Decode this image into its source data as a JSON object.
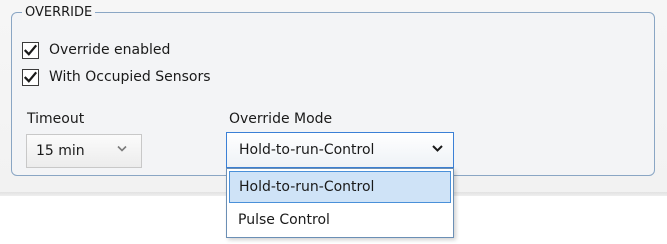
{
  "override_group": {
    "legend": "OVERRIDE",
    "override_enabled": {
      "label": "Override enabled",
      "checked": true
    },
    "with_occupied_sensors": {
      "label": "With Occupied Sensors",
      "checked": true
    },
    "timeout": {
      "label": "Timeout",
      "value": "15 min"
    },
    "override_mode": {
      "label": "Override Mode",
      "value": "Hold-to-run-Control",
      "options": [
        "Hold-to-run-Control",
        "Pulse Control"
      ],
      "highlighted_option": "Hold-to-run-Control",
      "expanded": true
    }
  },
  "icons": {
    "checkmark": "checkmark-icon",
    "chevron": "chevron-down-icon"
  },
  "colors": {
    "group_border": "#8aa6c4",
    "focus_border": "#3b80d6",
    "highlight_bg": "#cfe3f7",
    "highlight_border": "#4a90d9"
  }
}
